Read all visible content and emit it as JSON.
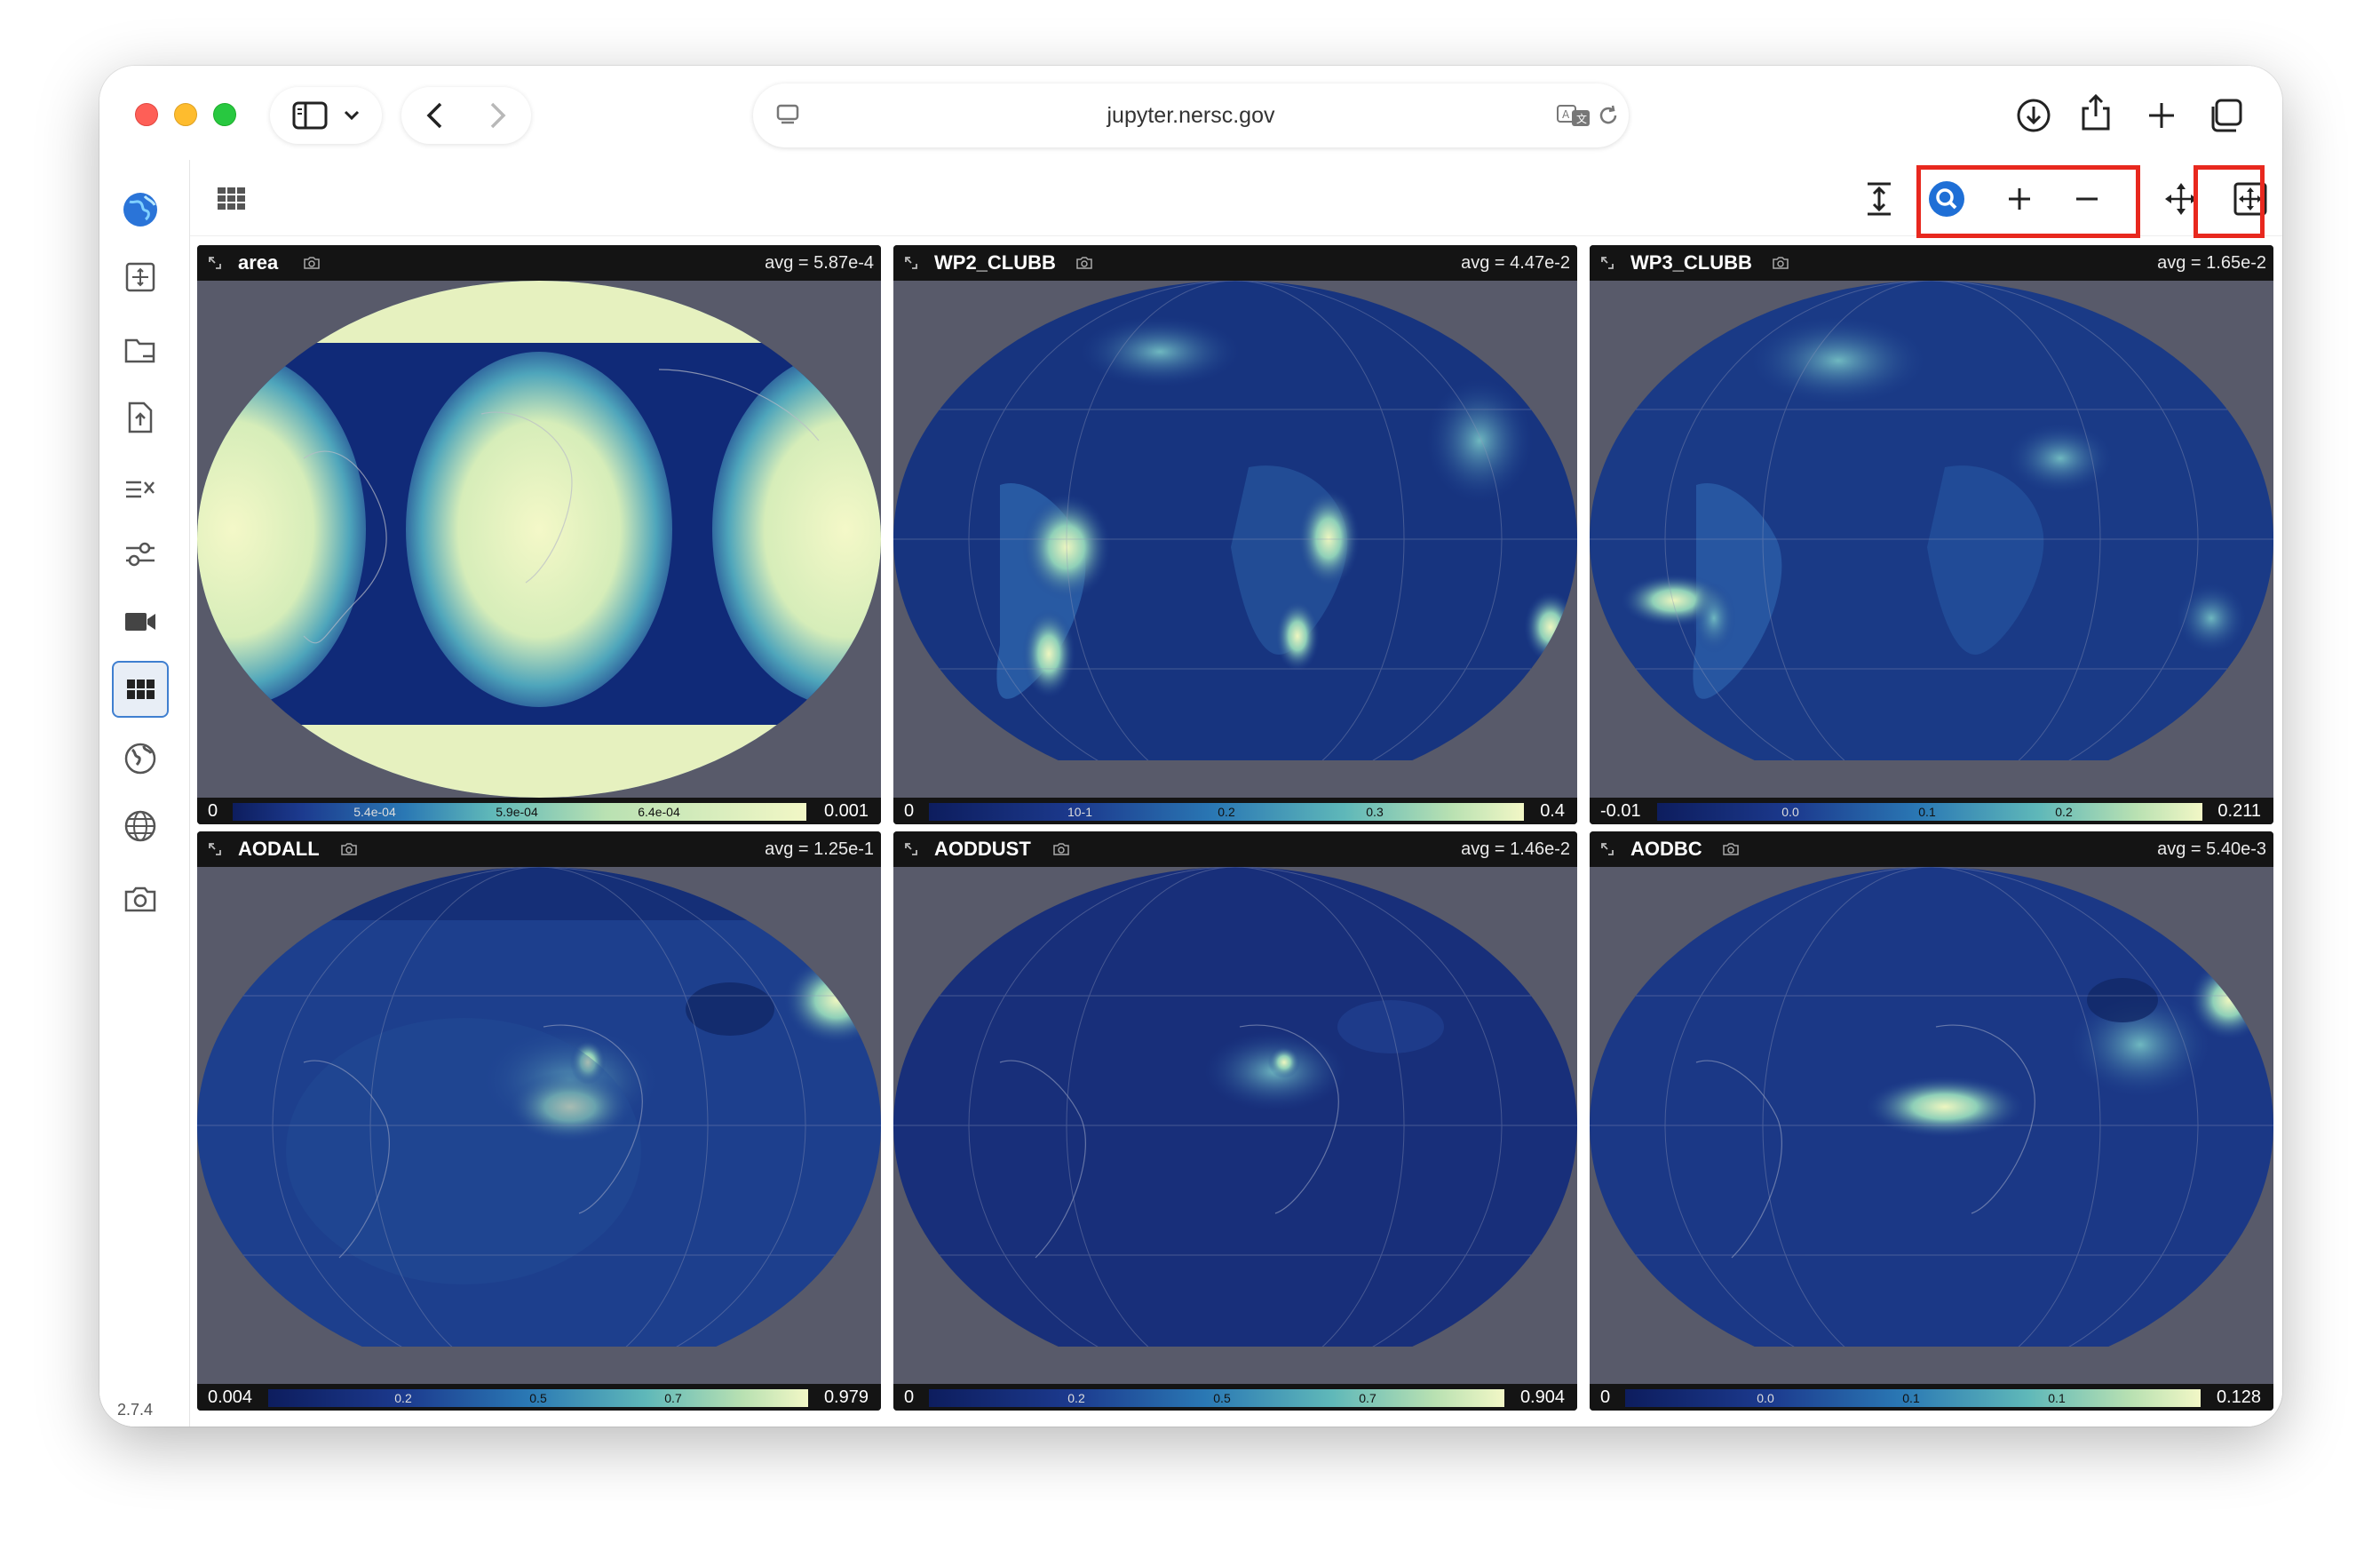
{
  "browser": {
    "url": "jupyter.nersc.gov"
  },
  "app": {
    "version": "2.7.4"
  },
  "panels": [
    {
      "title": "area",
      "avg": "avg = 5.87e-4",
      "min": "0",
      "max": "0.001",
      "ticks": [
        "5.4e-04",
        "5.9e-04",
        "6.4e-04"
      ]
    },
    {
      "title": "WP2_CLUBB",
      "avg": "avg = 4.47e-2",
      "min": "0",
      "max": "0.4",
      "ticks": [
        "10-1",
        "0.2",
        "0.3"
      ]
    },
    {
      "title": "WP3_CLUBB",
      "avg": "avg = 1.65e-2",
      "min": "-0.01",
      "max": "0.211",
      "ticks": [
        "0.0",
        "0.1",
        "0.2"
      ]
    },
    {
      "title": "AODALL",
      "avg": "avg = 1.25e-1",
      "min": "0.004",
      "max": "0.979",
      "ticks": [
        "0.2",
        "0.5",
        "0.7"
      ]
    },
    {
      "title": "AODDUST",
      "avg": "avg = 1.46e-2",
      "min": "0",
      "max": "0.904",
      "ticks": [
        "0.2",
        "0.5",
        "0.7"
      ]
    },
    {
      "title": "AODBC",
      "avg": "avg = 5.40e-3",
      "min": "0",
      "max": "0.128",
      "ticks": [
        "0.0",
        "0.1",
        "0.1"
      ]
    }
  ],
  "colors": {
    "highlight": "#e8281e",
    "accent": "#3f7fd0"
  }
}
